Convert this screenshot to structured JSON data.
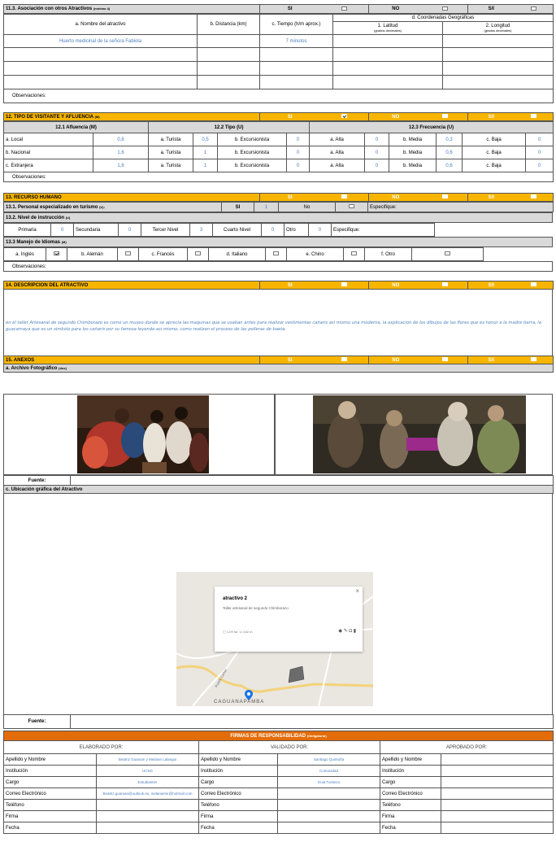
{
  "s11": {
    "title": "11.3. Asociación con otros Atractivos",
    "title_note": "(mínimo 4)",
    "si": "SI",
    "no": "NO",
    "si_no": "S/I",
    "col_name": "a. Nombre del atractivo",
    "col_dist": "b. Distancia (km)",
    "col_time": "c. Tiempo (h/m aprox.)",
    "col_coord": "d. Coordenadas Geográficas",
    "col_lat": "1. Latitud",
    "col_lon": "2. Longitud",
    "col_dec": "(grados decimales)",
    "row1_name": "Huerto medicinal de la señora Fabiola",
    "row1_time": "7 minutos",
    "obs": "Observaciones:"
  },
  "s12": {
    "title": "12. TIPO DE VISITANTE Y AFLUENCIA",
    "title_note": "(M)",
    "si": "SI",
    "no": "NO",
    "si_no": "S/I",
    "h1": "12.1 Afluencia (M)",
    "h2": "12.2 Tipo (U)",
    "h3": "12.3 Frecuencia (U)",
    "rows": [
      {
        "label": "a. Local",
        "af": "0,8",
        "tur": "a. Turista",
        "tv": "0,5",
        "exc": "b. Excursionista",
        "ev": "0",
        "alta": "a. Alta",
        "av": "0",
        "media": "b. Media",
        "mv": "0,3",
        "baja": "c. Baja",
        "bv": "0"
      },
      {
        "label": "b. Nacional",
        "af": "1,6",
        "tur": "a. Turista",
        "tv": "1",
        "exc": "b. Excursionista",
        "ev": "0",
        "alta": "a. Alta",
        "av": "0",
        "media": "b. Media",
        "mv": "0,6",
        "baja": "c. Baja",
        "bv": "0"
      },
      {
        "label": "c. Extranjera",
        "af": "1,6",
        "tur": "a. Turista",
        "tv": "1",
        "exc": "b. Excursionista",
        "ev": "0",
        "alta": "a. Alta",
        "av": "0",
        "media": "b. Media",
        "mv": "0,6",
        "baja": "c. Baja",
        "bv": "0"
      }
    ],
    "obs": "Observaciones:"
  },
  "s13": {
    "title": "13. RECURSO HUMANO",
    "si": "SI",
    "no": "NO",
    "si_no": "S/I",
    "r1_label": "13.1. Personal especializado en turismo",
    "r1_note": "(U):",
    "r1_si": "SI",
    "r1_val": "1",
    "r1_no": "No",
    "r1_esp": "Especifique:",
    "r2_label": "13.2. Nivel de instrucción",
    "r2_note": "(U)",
    "prim": "Primaria",
    "prim_v": "0",
    "sec": "Secundaria",
    "sec_v": "0",
    "ter": "Tercer Nivel",
    "ter_v": "3",
    "cua": "Cuarto Nivel",
    "cua_v": "0",
    "otro": "Otro",
    "otro_v": "0",
    "esp": "Especifique:",
    "r3_label": "13.3 Manejo de Idiomas",
    "r3_note": "(M)",
    "ingles": "a. Inglés",
    "aleman": "b. Alemán",
    "frances": "c. Francés",
    "italiano": "d. Italiano",
    "chino": "e. Chino",
    "otro_id": "f. Otro",
    "obs": "Observaciones:"
  },
  "s14": {
    "title": "14. DESCRIPCION DEL ATRACTIVO",
    "si": "SI",
    "no": "NO",
    "si_no": "S/I",
    "text_pre": "en el taller ",
    "text_it": "Artesanal de segundo Chimborazo",
    "text_post": " es como un museo donde se aprecia las maquinas que se usaban antes para realizar vestimentas cañaris asi mismo una moderna, la explicacion de los dibujos de las flores que es honor a la madre tierra, la guacamaya que es un simbolo para los cañaris por su famosa leyenda asi mismo, como realizan el proceso de las polleras de baeta."
  },
  "s15": {
    "title": "15. ANEXOS",
    "si": "SI",
    "no": "NO",
    "si_no": "S/I",
    "photo_label": "a. Archivo Fotográfico",
    "photo_note": "(dos)",
    "fuente": "Fuente:",
    "map_label": "c. Ubicación gráfica del Atractivo",
    "map_card_title": "atractivo 2",
    "map_card_sub": "Taller artesanal de segundo Chimborazo",
    "map_card_area": "1,09 ha",
    "map_card_perim": "442 m",
    "map_card_close": "×",
    "map_place": "CAGUANAPAMBA",
    "map_road": "Pueblo Cañari"
  },
  "firmas": {
    "title": "FIRMAS DE RESPONSABILIDAD",
    "title_note": "(Obligatorio)",
    "elab": "ELABORADO POR:",
    "valid": "VALIDADO POR:",
    "aprob": "APROBADO POR:",
    "fields": [
      "Apellido y Nombre",
      "Institución",
      "Cargo",
      "Correo Electrónico",
      "Teléfono",
      "Firma",
      "Fecha"
    ],
    "elab_vals": [
      "Beatriz Guaman y Melanie Lalangui",
      "UCSG",
      "Estudiantes",
      "Beatriz.guaman@outlook.es, melaniemir@hotmail.com",
      "",
      "",
      ""
    ],
    "valid_vals": [
      "Santiago Quintuña",
      "Comunidad",
      "Guia Turistico",
      "",
      "",
      "",
      ""
    ]
  },
  "colors": {
    "header_yellow": "#f7b500",
    "header_orange": "#e36c0a",
    "value_blue": "#4f81bd",
    "subheader_gray": "#d9d9d9"
  }
}
